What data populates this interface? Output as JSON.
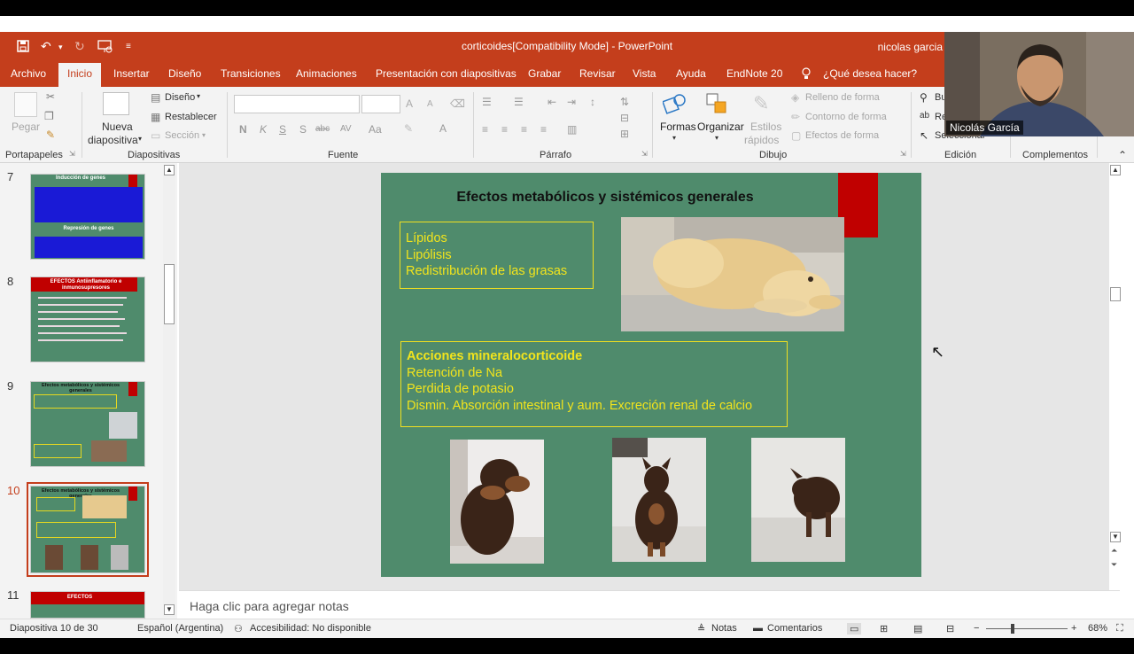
{
  "window": {
    "title": "corticoides[Compatibility Mode]  -  PowerPoint",
    "user": "nicolas garcia"
  },
  "menu": {
    "tabs": [
      "Archivo",
      "Inicio",
      "Insertar",
      "Diseño",
      "Transiciones",
      "Animaciones",
      "Presentación con diapositivas",
      "Grabar",
      "Revisar",
      "Vista",
      "Ayuda",
      "EndNote 20"
    ],
    "active": "Inicio",
    "search_placeholder": "¿Qué desea hacer?"
  },
  "ribbon": {
    "portapapeles": {
      "label": "Portapapeles",
      "pegar": "Pegar"
    },
    "diapositivas": {
      "label": "Diapositivas",
      "nueva_line1": "Nueva",
      "nueva_line2": "diapositiva",
      "diseno": "Diseño",
      "restablecer": "Restablecer",
      "seccion": "Sección"
    },
    "fuente": {
      "label": "Fuente"
    },
    "parrafo": {
      "label": "Párrafo"
    },
    "dibujo": {
      "label": "Dibujo",
      "formas": "Formas",
      "organizar": "Organizar",
      "estilos1": "Estilos",
      "estilos2": "rápidos",
      "relleno": "Relleno de forma",
      "contorno": "Contorno de forma",
      "efectos": "Efectos de forma"
    },
    "edicion": {
      "label": "Edición",
      "buscar": "Bu",
      "reemplazar": "Re",
      "seleccionar": "Seleccionar"
    },
    "complementos": {
      "label": "Complementos"
    }
  },
  "thumbnails": [
    {
      "number": "7",
      "title": "Inducción de genes",
      "title2": "Represión de genes"
    },
    {
      "number": "8",
      "title": "EFECTOS Antiinflamatorio e inmunosupresores"
    },
    {
      "number": "9",
      "title": "Efectos metabólicos y sistémicos generales"
    },
    {
      "number": "10",
      "title": "Efectos metabólicos y sistémicos generales"
    },
    {
      "number": "11",
      "title": "EFECTOS"
    }
  ],
  "selected_slide": "10",
  "slide": {
    "title": "Efectos metabólicos y sistémicos generales",
    "box1": {
      "lines": [
        "Lípidos",
        "Lipólisis",
        "Redistribución de las grasas"
      ]
    },
    "box2": {
      "heading": "Acciones mineralocorticoide",
      "lines": [
        "Retención de Na",
        "Perdida de potasio",
        "Dismin. Absorción intestinal y aum. Excreción renal de calcio"
      ]
    },
    "colors": {
      "background": "#4f8b6c",
      "accent": "#c00000",
      "text": "#f2e41c"
    }
  },
  "notes_placeholder": "Haga clic para agregar notas",
  "status": {
    "slide_counter": "Diapositiva 10 de 30",
    "language": "Español (Argentina)",
    "accessibility": "Accesibilidad: No disponible",
    "notas": "Notas",
    "comentarios": "Comentarios",
    "zoom": "68%",
    "zoom_level": 0.68
  },
  "webcam": {
    "caption": "Nicolás García"
  },
  "icons": [
    "save-icon",
    "undo-icon",
    "redo-icon",
    "slideshow-icon",
    "customize-icon",
    "lightbulb-icon",
    "paste-icon",
    "cut-icon",
    "copy-icon",
    "format-painter-icon",
    "new-slide-icon",
    "shapes-icon",
    "arrange-icon",
    "quick-styles-icon",
    "search-icon",
    "cursor-icon",
    "notes-icon",
    "comments-icon",
    "normal-view-icon",
    "sorter-view-icon",
    "reading-view-icon",
    "presenter-view-icon"
  ]
}
